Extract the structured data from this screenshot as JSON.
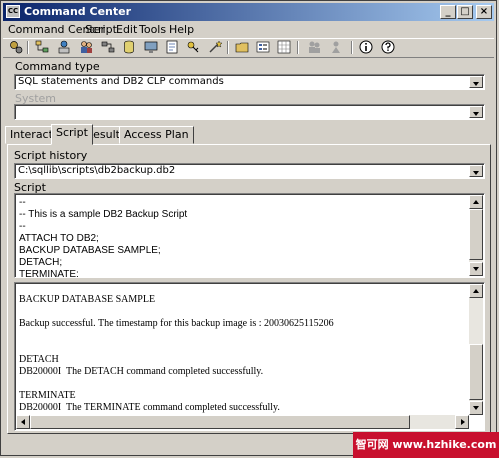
{
  "window": {
    "title": "Command Center",
    "icon_text": "CC"
  },
  "title_buttons": {
    "minimize": "_",
    "maximize": "□",
    "close": "×"
  },
  "menu": [
    "Command Center",
    "Script",
    "Edit",
    "Tools",
    "Help"
  ],
  "toolbar_icons": [
    "tools-icon",
    "tree-icon",
    "network-icon",
    "users-icon",
    "flow-icon",
    "database-icon",
    "monitor-icon",
    "journal-icon",
    "key-icon",
    "wand-icon",
    "folder-icon",
    "list-icon",
    "grid-icon",
    "people-icon",
    "person-icon",
    "info-icon",
    "help-icon"
  ],
  "command_type": {
    "label": "Command type",
    "value": "SQL statements and DB2 CLP commands"
  },
  "system": {
    "label": "System",
    "value": ""
  },
  "tabs": [
    "Interactive",
    "Script",
    "Results",
    "Access Plan"
  ],
  "active_tab": "Script",
  "script_history": {
    "label": "Script history",
    "value": "C:\\sqllib\\scripts\\db2backup.db2"
  },
  "script": {
    "label": "Script",
    "lines": [
      "--",
      "-- This is a sample DB2 Backup Script",
      "--",
      "ATTACH TO DB2;",
      "BACKUP DATABASE SAMPLE;",
      "DETACH;",
      "TERMINATE;"
    ]
  },
  "output": {
    "lines": [
      "BACKUP DATABASE SAMPLE",
      "Backup successful. The timestamp for this backup image is : 20030625115206",
      "DETACH",
      "DB20000I  The DETACH command completed successfully.",
      "TERMINATE",
      "DB20000I  The TERMINATE command completed successfully."
    ]
  },
  "watermark": "智可网 www.hzhike.com",
  "colors": {
    "titlebar_start": "#0a246a",
    "titlebar_end": "#a6caf0",
    "face": "#d4d0c8",
    "watermark": "#c8102e"
  }
}
